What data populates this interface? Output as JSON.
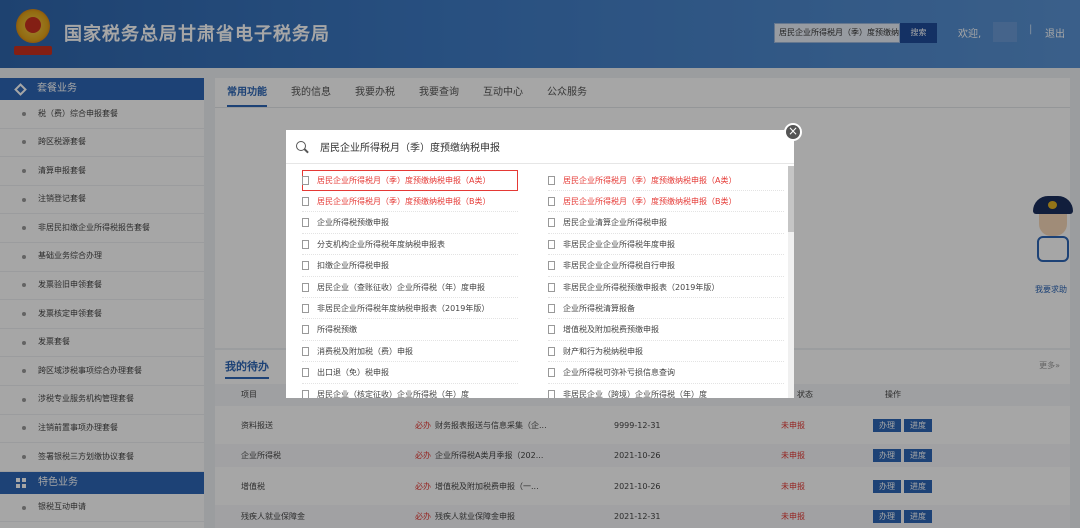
{
  "header": {
    "title": "国家税务总局甘肃省电子税务局",
    "search_value": "居民企业所得税月（季）度预缴纳税申报",
    "search_button": "搜索",
    "welcome": "欢迎,",
    "separator": "|",
    "logout": "退出"
  },
  "sidebar": {
    "section1": "套餐业务",
    "items": [
      "税（费）综合申报套餐",
      "跨区税源套餐",
      "清算申报套餐",
      "注销登记套餐",
      "非居民扣缴企业所得税报告套餐",
      "基础业务综合办理",
      "发票验旧申领套餐",
      "发票核定申领套餐",
      "发票套餐",
      "跨区域涉税事项综合办理套餐",
      "涉税专业服务机构管理套餐",
      "注销前置事项办理套餐",
      "签署银税三方划缴协议套餐"
    ],
    "section2": "特色业务",
    "items2": [
      "银税互动申请"
    ]
  },
  "tabs": [
    "常用功能",
    "我的信息",
    "我要办税",
    "我要查询",
    "互动中心",
    "公众服务"
  ],
  "todo": {
    "title": "我的待办",
    "more": "更多»",
    "columns": [
      "项目",
      "状态",
      "操作"
    ],
    "must_label": "必办",
    "rows": [
      {
        "item": "资料报送",
        "desc": "财务报表报送与信息采集（企...",
        "date": "9999-12-31",
        "status": "未申报"
      },
      {
        "item": "企业所得税",
        "desc": "企业所得税A类月季报（202...",
        "date": "2021-10-26",
        "status": "未申报"
      },
      {
        "item": "增值税",
        "desc": "增值税及附加税费申报（一...",
        "date": "2021-10-26",
        "status": "未申报"
      },
      {
        "item": "残疾人就业保障金",
        "desc": "残疾人就业保障金申报",
        "date": "2021-12-31",
        "status": "未申报"
      }
    ],
    "btn_do": "办理",
    "btn_progress": "进度"
  },
  "help": "我要求助",
  "modal": {
    "query": "居民企业所得税月（季）度预缴纳税申报",
    "close": "×",
    "left": [
      "居民企业所得税月（季）度预缴纳税申报（A类）",
      "居民企业所得税月（季）度预缴纳税申报（B类）",
      "企业所得税预缴申报",
      "分支机构企业所得税年度纳税申报表",
      "扣缴企业所得税申报",
      "居民企业（查账征收）企业所得税（年）度申报",
      "非居民企业所得税年度纳税申报表（2019年版）",
      "所得税预缴",
      "消费税及附加税（费）申报",
      "出口退（免）税申报",
      "居民企业（核定征收）企业所得税（年）度"
    ],
    "right": [
      "居民企业所得税月（季）度预缴纳税申报（A类）",
      "居民企业所得税月（季）度预缴纳税申报（B类）",
      "居民企业清算企业所得税申报",
      "非居民企业企业所得税年度申报",
      "非居民企业企业所得税自行申报",
      "非居民企业所得税预缴申报表（2019年版）",
      "企业所得税清算报备",
      "增值税及附加税费预缴申报",
      "财产和行为税纳税申报",
      "企业所得税可弥补亏损信息查询",
      "非居民企业（跨境）企业所得税（年）度"
    ]
  },
  "colors": {
    "brand": "#2d66b5",
    "highlight": "#e53935"
  }
}
